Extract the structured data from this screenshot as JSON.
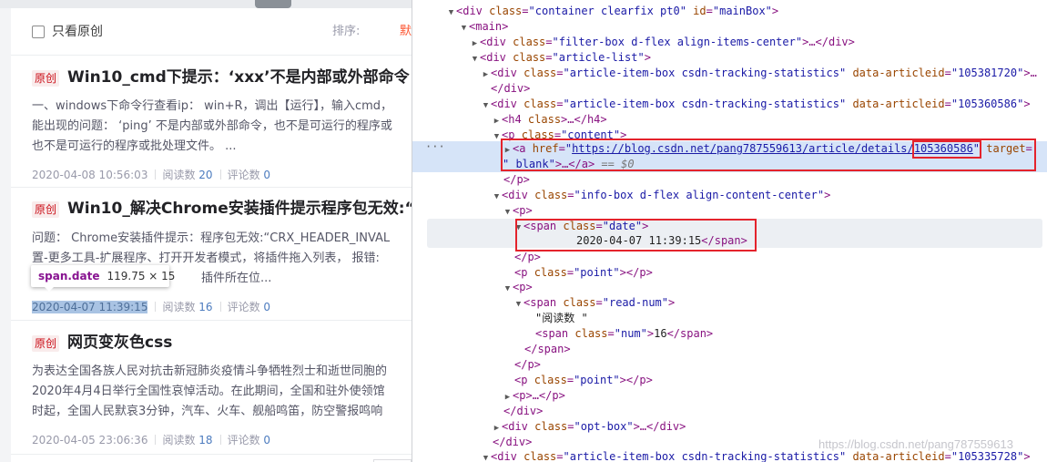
{
  "filter": {
    "only_original_label": "只看原创",
    "sort_label": "排序:",
    "sort_value": "默认"
  },
  "articles": [
    {
      "tag": "原创",
      "title": "Win10_cmd下提示：‘xxx’不是内部或外部命令",
      "desc": [
        "一、windows下命令行查看ip： win+R，调出【运行】，输入cmd，",
        "能出现的问题： ‘ping’ 不是内部或外部命令，也不是可运行的程序或",
        "也不是可运行的程序或批处理文件。 ..."
      ],
      "date": "2020-04-08 10:56:03",
      "read_label": "阅读数",
      "read_num": "20",
      "comment_label": "评论数",
      "comment_num": "0"
    },
    {
      "tag": "原创",
      "title": "Win10_解决Chrome安装插件提示程序包无效:“",
      "desc": [
        "问题： Chrome安装插件提示：程序包无效:“CRX_HEADER_INVAL",
        "置-更多工具-扩展程序、打开开发者模式，将插件拖入列表， 报错:",
        "插件所在位..."
      ],
      "date": "2020-04-07 11:39:15",
      "read_label": "阅读数",
      "read_num": "16",
      "comment_label": "评论数",
      "comment_num": "0"
    },
    {
      "tag": "原创",
      "title": "网页变灰色css",
      "desc": [
        "为表达全国各族人民对抗击新冠肺炎疫情斗争牺牲烈士和逝世同胞的",
        "2020年4月4日举行全国性哀悼活动。在此期间，全国和驻外使领馆",
        "时起，全国人民默哀3分钟，汽车、火车、舰船鸣笛，防空警报鸣响"
      ],
      "date": "2020-04-05 23:06:36",
      "read_label": "阅读数",
      "read_num": "18",
      "comment_label": "评论数",
      "comment_num": "0"
    }
  ],
  "tooltip": {
    "name": "span.date",
    "size": "119.75 × 15"
  },
  "devtools": {
    "l0": {
      "tag": "div",
      "attr": "class",
      "val": "container clearfix pt0",
      "attr2": "id",
      "val2": "mainBox"
    },
    "l1": {
      "tag": "main"
    },
    "l2": {
      "tag": "div",
      "attr": "class",
      "val": "filter-box d-flex align-items-center",
      "rest": "…</div>"
    },
    "l3": {
      "tag": "div",
      "attr": "class",
      "val": "article-list"
    },
    "l4": {
      "tag": "div",
      "attr": "class",
      "val": "article-item-box csdn-tracking-statistics",
      "attr2": "data-articleid",
      "val2": "105381720",
      "rest": "…"
    },
    "l5": {
      "close": "</div>"
    },
    "l6": {
      "tag": "div",
      "attr": "class",
      "val": "article-item-box csdn-tracking-statistics",
      "attr2": "data-articleid",
      "val2": "105360586"
    },
    "l7": {
      "tag": "h4",
      "attr": "class",
      "rest": "…</h4>"
    },
    "l8": {
      "tag": "p",
      "attr": "class",
      "val": "content"
    },
    "l9": {
      "tag": "a",
      "attr": "href",
      "url": "https://blog.csdn.net/pang787559613/article/details/",
      "id": "105360586",
      "attr2": "target"
    },
    "l10": {
      "val": "_blank",
      "rest": "…</a>",
      "eq": "== $0"
    },
    "l11": {
      "close": "</p>"
    },
    "l12": {
      "tag": "div",
      "attr": "class",
      "val": "info-box d-flex align-content-center"
    },
    "l13": {
      "tag": "p"
    },
    "l14": {
      "tag": "span",
      "attr": "class",
      "val": "date"
    },
    "l15": {
      "text": "2020-04-07 11:39:15",
      "close": "</span>"
    },
    "l16": {
      "close": "</p>"
    },
    "l17": {
      "tag": "p",
      "attr": "class",
      "val": "point",
      "close": "</p>"
    },
    "l18": {
      "tag": "p"
    },
    "l19": {
      "tag": "span",
      "attr": "class",
      "val": "read-num"
    },
    "l20": {
      "text": "\"阅读数 \""
    },
    "l21": {
      "tag": "span",
      "attr": "class",
      "val": "num",
      "text": "16",
      "close": "</span>"
    },
    "l22": {
      "close": "</span>"
    },
    "l23": {
      "close": "</p>"
    },
    "l24": {
      "tag": "p",
      "attr": "class",
      "val": "point",
      "close": "</p>"
    },
    "l25": {
      "tag": "p",
      "rest": "…</p>"
    },
    "l26": {
      "close": "</div>"
    },
    "l27": {
      "tag": "div",
      "attr": "class",
      "val": "opt-box",
      "rest": "…</div>"
    },
    "l28": {
      "close": "</div>"
    },
    "l29": {
      "tag": "div",
      "attr": "class",
      "val": "article-item-box csdn-tracking-statistics",
      "attr2": "data-articleid",
      "val2": "105335728"
    }
  },
  "watermark": "https://blog.csdn.net/pang787559613"
}
